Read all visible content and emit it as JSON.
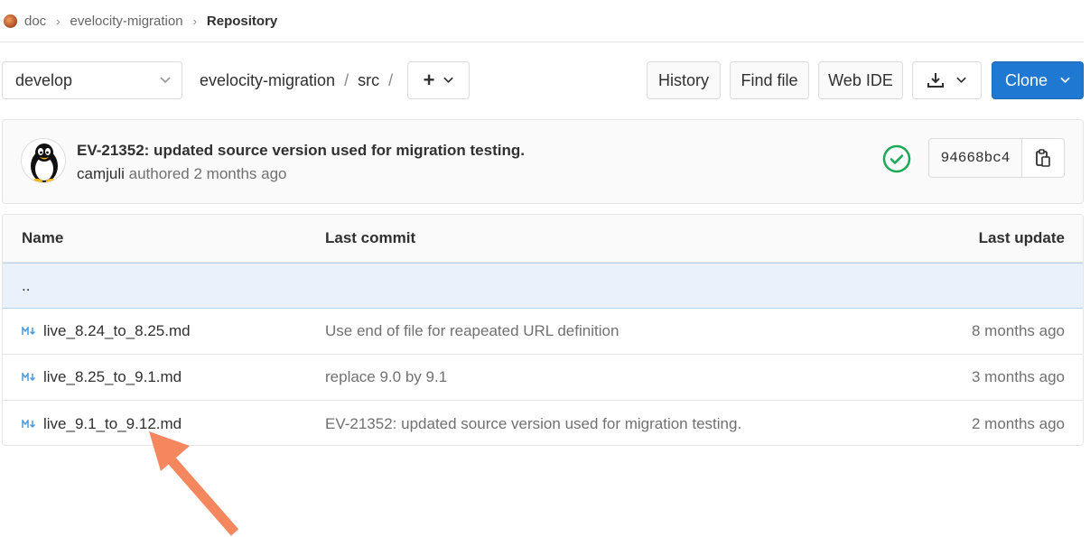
{
  "breadcrumb": {
    "group": "doc",
    "project": "evelocity-migration",
    "current": "Repository"
  },
  "toolbar": {
    "branch": "develop",
    "path_root": "evelocity-migration",
    "path_sep": "/",
    "path_dir": "src",
    "add_label": "+",
    "history_label": "History",
    "find_file_label": "Find file",
    "web_ide_label": "Web IDE",
    "clone_label": "Clone"
  },
  "last_commit": {
    "title": "EV-21352: updated source version used for migration testing.",
    "author": "camjuli",
    "authored_text": "authored",
    "time": "2 months ago",
    "sha": "94668bc4"
  },
  "table": {
    "headers": {
      "name": "Name",
      "last_commit": "Last commit",
      "last_update": "Last update"
    },
    "parent_link": "..",
    "rows": [
      {
        "name": "live_8.24_to_8.25.md",
        "commit": "Use end of file for reapeated URL definition",
        "updated": "8 months ago"
      },
      {
        "name": "live_8.25_to_9.1.md",
        "commit": "replace 9.0 by 9.1",
        "updated": "3 months ago"
      },
      {
        "name": "live_9.1_to_9.12.md",
        "commit": "EV-21352: updated source version used for migration testing.",
        "updated": "2 months ago"
      }
    ]
  },
  "colors": {
    "accent": "#1f78d1",
    "success": "#1aaa55",
    "annotation": "#f4875e",
    "parent_row_bg": "#e9f2fb"
  },
  "icons": {
    "file_type": "markdown-icon",
    "status": "check-circle-icon",
    "copy": "clipboard-icon"
  }
}
